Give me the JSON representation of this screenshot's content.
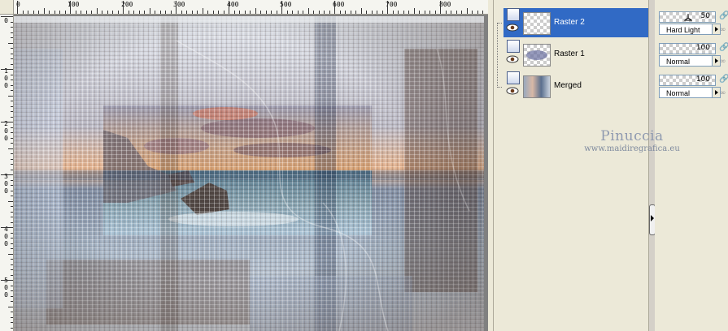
{
  "ruler": {
    "top_labels": [
      "0",
      "100",
      "200",
      "300",
      "400",
      "500",
      "600",
      "700",
      "800"
    ],
    "left_labels": [
      "0",
      "100",
      "200",
      "300",
      "400",
      "500"
    ]
  },
  "layers": [
    {
      "name": "Raster 2",
      "selected": true,
      "thumbnail": "transparent",
      "opacity": "50",
      "blend_mode": "Hard Light"
    },
    {
      "name": "Raster 1",
      "selected": false,
      "thumbnail": "mask-oval",
      "opacity": "100",
      "blend_mode": "Normal"
    },
    {
      "name": "Merged",
      "selected": false,
      "thumbnail": "image",
      "opacity": "100",
      "blend_mode": "Normal"
    }
  ],
  "watermark": {
    "title": "Pinuccia",
    "url": "www.maidiregrafica.eu"
  },
  "colors": {
    "selection": "#316ac5",
    "panel": "#ece9d8",
    "workspace": "#d4d0c8"
  },
  "icons": [
    "eye-icon",
    "layer-visibility-icon",
    "lock-icon",
    "dropdown-arrow-icon",
    "splitter-grip-icon"
  ]
}
